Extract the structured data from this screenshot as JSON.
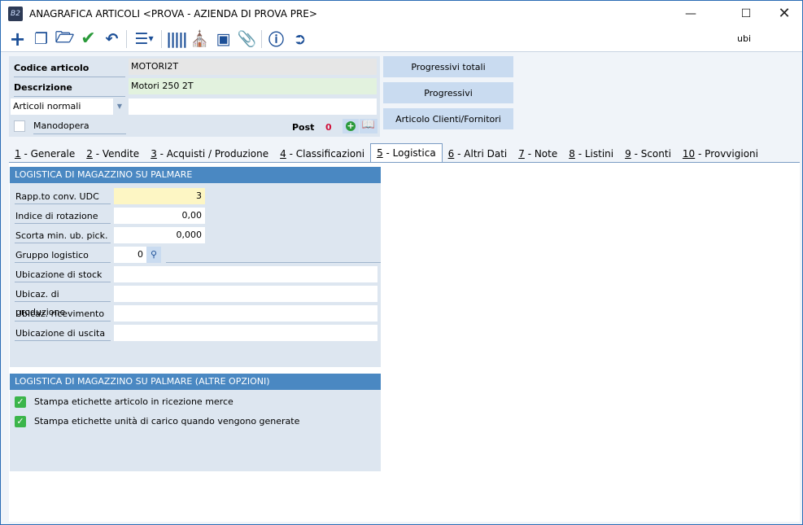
{
  "window": {
    "title": "ANAGRAFICA ARTICOLI <PROVA - AZIENDA DI PROVA PRE>",
    "app_icon": "B2"
  },
  "toolbar": {
    "search_value": "ubi"
  },
  "header": {
    "codice_label": "Codice articolo",
    "codice_value": "MOTORI2T",
    "descrizione_label": "Descrizione",
    "descrizione_value": "Motori 250 2T",
    "tipo_value": "Articoli normali",
    "extra_value": "",
    "manodopera_label": "Manodopera",
    "post_label": "Post",
    "post_count": "0"
  },
  "buttons": {
    "progressivi_totali": "Progressivi totali",
    "progressivi": "Progressivi",
    "clienti_fornitori": "Articolo Clienti/Fornitori"
  },
  "tabs": [
    {
      "num": "1",
      "label": " - Generale"
    },
    {
      "num": "2",
      "label": " - Vendite"
    },
    {
      "num": "3",
      "label": " - Acquisti / Produzione"
    },
    {
      "num": "4",
      "label": " - Classificazioni"
    },
    {
      "num": "5",
      "label": " - Logistica"
    },
    {
      "num": "6",
      "label": " - Altri Dati"
    },
    {
      "num": "7",
      "label": " - Note"
    },
    {
      "num": "8",
      "label": " - Listini"
    },
    {
      "num": "9",
      "label": " - Sconti"
    },
    {
      "num": "10",
      "label": " - Provvigioni"
    }
  ],
  "logistica": {
    "title": "LOGISTICA DI MAGAZZINO SU PALMARE",
    "fields": [
      {
        "label": "Rapp.to conv. UDC",
        "value": "3"
      },
      {
        "label": "Indice di rotazione",
        "value": "0,00"
      },
      {
        "label": "Scorta min. ub.  pick.",
        "value": "0,000"
      },
      {
        "label": "Gruppo logistico",
        "value": "0"
      },
      {
        "label": "Ubicazione di stock",
        "value": ""
      },
      {
        "label": "Ubicaz. di produzione",
        "value": ""
      },
      {
        "label": "Ubicaz. ricevimento",
        "value": ""
      },
      {
        "label": "Ubicazione di uscita",
        "value": ""
      }
    ]
  },
  "opzioni": {
    "title": "LOGISTICA DI MAGAZZINO SU PALMARE (ALTRE OPZIONI)",
    "items": [
      {
        "label": "Stampa etichette articolo in ricezione merce",
        "checked": true
      },
      {
        "label": "Stampa etichette unità di carico quando vengono generate",
        "checked": true
      }
    ]
  }
}
